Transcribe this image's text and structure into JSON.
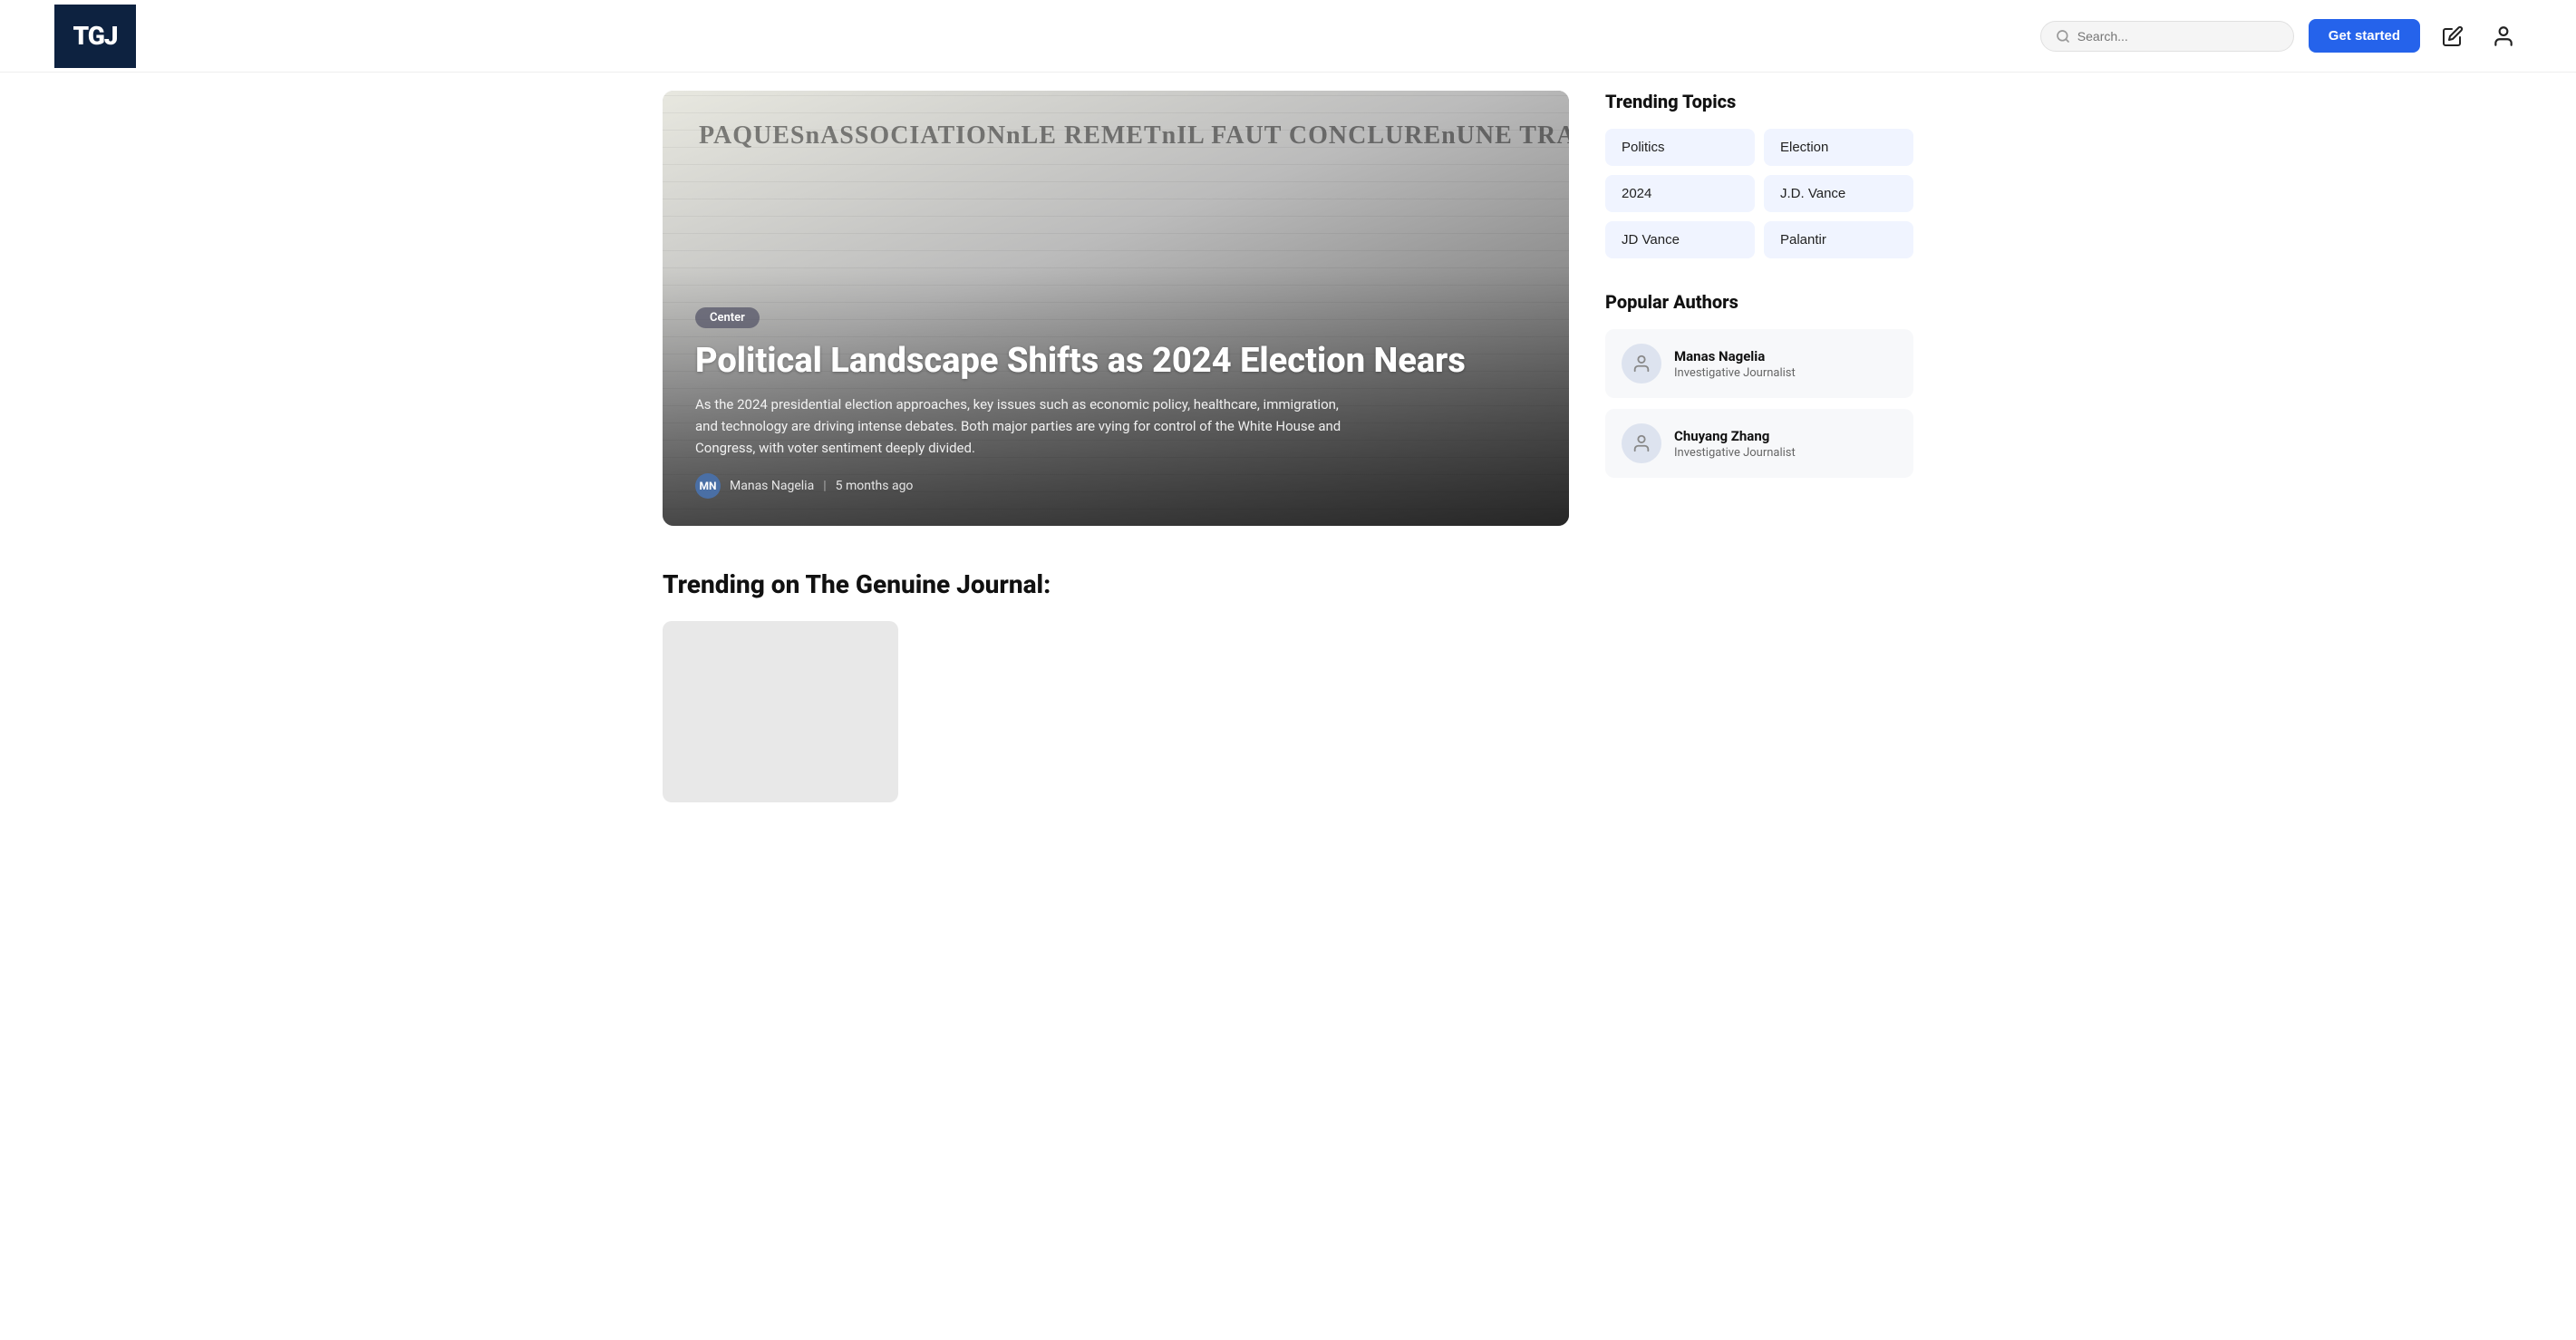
{
  "header": {
    "logo": "TGJ",
    "search_placeholder": "Search...",
    "get_started_label": "Get started"
  },
  "hero": {
    "badge": "Center",
    "title": "Political Landscape Shifts as 2024 Election Nears",
    "description": "As the 2024 presidential election approaches, key issues such as economic policy, healthcare, immigration, and technology are driving intense debates. Both major parties are vying for control of the White House and Congress, with voter sentiment deeply divided.",
    "author_name": "Manas Nagelia",
    "time_ago": "5 months ago"
  },
  "trending": {
    "section_title": "Trending on The Genuine Journal:"
  },
  "sidebar": {
    "trending_topics_title": "Trending Topics",
    "topics": [
      {
        "label": "Politics"
      },
      {
        "label": "Election"
      },
      {
        "label": "2024"
      },
      {
        "label": "J.D. Vance"
      },
      {
        "label": "JD Vance"
      },
      {
        "label": "Palantir"
      }
    ],
    "popular_authors_title": "Popular Authors",
    "authors": [
      {
        "name": "Manas Nagelia",
        "role": "Investigative Journalist"
      },
      {
        "name": "Chuyang Zhang",
        "role": "Investigative Journalist"
      }
    ]
  }
}
